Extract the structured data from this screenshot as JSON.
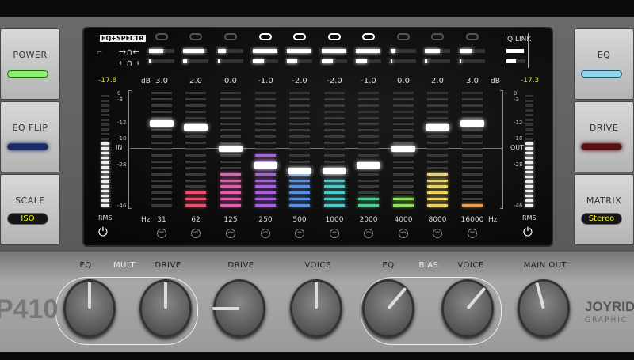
{
  "left_buttons": [
    {
      "label": "POWER",
      "led": "#8ef070"
    },
    {
      "label": "EQ FLIP",
      "led": "#1a2a6a"
    },
    {
      "label": "SCALE",
      "value": "ISO"
    }
  ],
  "right_buttons": [
    {
      "label": "EQ",
      "led": "#90d8f0"
    },
    {
      "label": "DRIVE",
      "led": "#5a1010"
    },
    {
      "label": "MATRIX",
      "value": "Stereo"
    }
  ],
  "display": {
    "mode_label": "EQ+SPECTR",
    "q_link_label": "Q LINK",
    "db_unit": "dB",
    "hz_unit": "Hz",
    "in_label": "IN",
    "out_label": "OUT",
    "rms_left": "RMS",
    "rms_right": "RMS",
    "in_level": "-17.8",
    "out_level": "-17.3",
    "meter_scale": [
      "0",
      "-3",
      "-12",
      "-18",
      "-28",
      "-46"
    ],
    "q_link": {
      "top": 0.9,
      "bottom": 0.5
    },
    "bands": [
      {
        "hz": "31",
        "gain": "3.0",
        "linked": false,
        "fader": 0.72,
        "spectrum": 0,
        "color": "#e8506e",
        "q_top": 0.55,
        "q_bottom": 0.05
      },
      {
        "hz": "62",
        "gain": "2.0",
        "linked": false,
        "fader": 0.69,
        "spectrum": 0.18,
        "color": "#e8506e",
        "q_top": 0.85,
        "q_bottom": 0.15
      },
      {
        "hz": "125",
        "gain": "0.0",
        "linked": false,
        "fader": 0.51,
        "spectrum": 0.33,
        "color": "#e060b0",
        "q_top": 0.3,
        "q_bottom": 0.05
      },
      {
        "hz": "250",
        "gain": "-1.0",
        "linked": true,
        "fader": 0.37,
        "spectrum": 0.47,
        "color": "#a860e0",
        "q_top": 0.95,
        "q_bottom": 0.45
      },
      {
        "hz": "500",
        "gain": "-2.0",
        "linked": true,
        "fader": 0.32,
        "spectrum": 0.3,
        "color": "#5890e0",
        "q_top": 0.95,
        "q_bottom": 0.4
      },
      {
        "hz": "1000",
        "gain": "-2.0",
        "linked": true,
        "fader": 0.32,
        "spectrum": 0.25,
        "color": "#50c8c8",
        "q_top": 0.95,
        "q_bottom": 0.45
      },
      {
        "hz": "2000",
        "gain": "-1.0",
        "linked": true,
        "fader": 0.37,
        "spectrum": 0.1,
        "color": "#50d090",
        "q_top": 0.95,
        "q_bottom": 0.45
      },
      {
        "hz": "4000",
        "gain": "0.0",
        "linked": false,
        "fader": 0.51,
        "spectrum": 0.1,
        "color": "#90e060",
        "q_top": 0.2,
        "q_bottom": 0.05
      },
      {
        "hz": "8000",
        "gain": "2.0",
        "linked": false,
        "fader": 0.69,
        "spectrum": 0.29,
        "color": "#e8d060",
        "q_top": 0.6,
        "q_bottom": 0.1
      },
      {
        "hz": "16000",
        "gain": "3.0",
        "linked": false,
        "fader": 0.72,
        "spectrum": 0.07,
        "color": "#e8a050",
        "q_top": 0.5,
        "q_bottom": 0.05
      }
    ]
  },
  "knob_labels": {
    "eq1": "EQ",
    "mult": "MULT",
    "drive1": "DRIVE",
    "drive2": "DRIVE",
    "voice1": "VOICE",
    "eq2": "EQ",
    "bias": "BIAS",
    "voice2": "VOICE",
    "main_out": "MAIN OUT"
  },
  "knobs": [
    0,
    0,
    -90,
    0,
    40,
    40,
    -15
  ],
  "model": "P410",
  "brand": "JOYRIDE",
  "brand_sub": "GRAPHIC"
}
